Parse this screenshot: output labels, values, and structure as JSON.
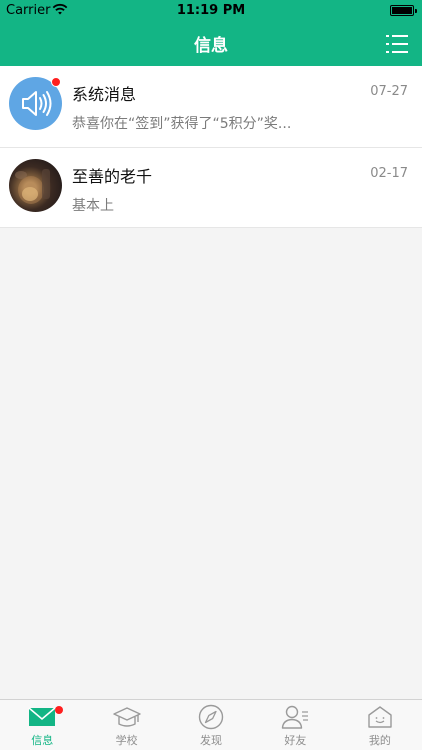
{
  "status_bar": {
    "carrier": "Carrier",
    "time": "11:19 PM"
  },
  "nav": {
    "title": "信息",
    "menu_icon": "list-menu-icon"
  },
  "messages": [
    {
      "title": "系统消息",
      "date": "07-27",
      "preview": "恭喜你在“签到”获得了“5积分”奖...",
      "avatar_icon": "speaker-icon",
      "unread": true
    },
    {
      "title": "至善的老千",
      "date": "02-17",
      "preview": "基本上",
      "avatar_icon": "user-photo",
      "unread": false
    }
  ],
  "tabs": [
    {
      "label": "信息",
      "icon": "mail-icon",
      "active": true,
      "badge": true
    },
    {
      "label": "学校",
      "icon": "graduation-cap-icon",
      "active": false,
      "badge": false
    },
    {
      "label": "发现",
      "icon": "compass-icon",
      "active": false,
      "badge": false
    },
    {
      "label": "好友",
      "icon": "friends-icon",
      "active": false,
      "badge": false
    },
    {
      "label": "我的",
      "icon": "home-face-icon",
      "active": false,
      "badge": false
    }
  ],
  "colors": {
    "brand": "#13b585",
    "badge": "#ff1f1f",
    "system_avatar": "#5fa6e4"
  }
}
